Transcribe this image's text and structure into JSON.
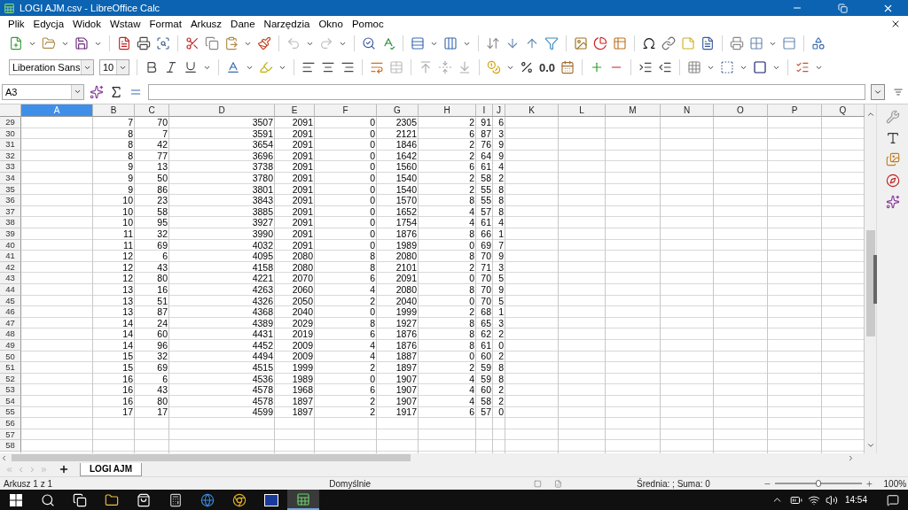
{
  "window": {
    "title": "LOGI AJM.csv - LibreOffice Calc"
  },
  "menu": [
    "Plik",
    "Edycja",
    "Widok",
    "Wstaw",
    "Format",
    "Arkusz",
    "Dane",
    "Narzędzia",
    "Okno",
    "Pomoc"
  ],
  "format_toolbar": {
    "font_name": "Liberation Sans",
    "font_size": "10",
    "decimal_format": "0.0"
  },
  "formula_bar": {
    "name_box": "A3"
  },
  "columns": [
    {
      "label": "A",
      "selected": true
    },
    {
      "label": "B",
      "selected": false
    },
    {
      "label": "C",
      "selected": false
    },
    {
      "label": "D",
      "selected": false
    },
    {
      "label": "E",
      "selected": false
    },
    {
      "label": "F",
      "selected": false
    },
    {
      "label": "G",
      "selected": false
    },
    {
      "label": "H",
      "selected": false
    },
    {
      "label": "I",
      "selected": false
    },
    {
      "label": "J",
      "selected": false
    },
    {
      "label": "K",
      "selected": false
    },
    {
      "label": "L",
      "selected": false
    },
    {
      "label": "M",
      "selected": false
    },
    {
      "label": "N",
      "selected": false
    },
    {
      "label": "O",
      "selected": false
    },
    {
      "label": "P",
      "selected": false
    },
    {
      "label": "Q",
      "selected": false
    }
  ],
  "rows": [
    {
      "number": "29",
      "values": [
        "7",
        "70",
        "3507",
        "2091",
        "0",
        "2305",
        "2",
        "91",
        "6"
      ]
    },
    {
      "number": "30",
      "values": [
        "8",
        "7",
        "3591",
        "2091",
        "0",
        "2121",
        "6",
        "87",
        "3"
      ]
    },
    {
      "number": "31",
      "values": [
        "8",
        "42",
        "3654",
        "2091",
        "0",
        "1846",
        "2",
        "76",
        "9"
      ]
    },
    {
      "number": "32",
      "values": [
        "8",
        "77",
        "3696",
        "2091",
        "0",
        "1642",
        "2",
        "64",
        "9"
      ]
    },
    {
      "number": "33",
      "values": [
        "9",
        "13",
        "3738",
        "2091",
        "0",
        "1560",
        "6",
        "61",
        "4"
      ]
    },
    {
      "number": "34",
      "values": [
        "9",
        "50",
        "3780",
        "2091",
        "0",
        "1540",
        "2",
        "58",
        "2"
      ]
    },
    {
      "number": "35",
      "values": [
        "9",
        "86",
        "3801",
        "2091",
        "0",
        "1540",
        "2",
        "55",
        "8"
      ]
    },
    {
      "number": "36",
      "values": [
        "10",
        "23",
        "3843",
        "2091",
        "0",
        "1570",
        "8",
        "55",
        "8"
      ]
    },
    {
      "number": "37",
      "values": [
        "10",
        "58",
        "3885",
        "2091",
        "0",
        "1652",
        "4",
        "57",
        "8"
      ]
    },
    {
      "number": "38",
      "values": [
        "10",
        "95",
        "3927",
        "2091",
        "0",
        "1754",
        "4",
        "61",
        "4"
      ]
    },
    {
      "number": "39",
      "values": [
        "11",
        "32",
        "3990",
        "2091",
        "0",
        "1876",
        "8",
        "66",
        "1"
      ]
    },
    {
      "number": "40",
      "values": [
        "11",
        "69",
        "4032",
        "2091",
        "0",
        "1989",
        "0",
        "69",
        "7"
      ]
    },
    {
      "number": "41",
      "values": [
        "12",
        "6",
        "4095",
        "2080",
        "8",
        "2080",
        "8",
        "70",
        "9"
      ]
    },
    {
      "number": "42",
      "values": [
        "12",
        "43",
        "4158",
        "2080",
        "8",
        "2101",
        "2",
        "71",
        "3"
      ]
    },
    {
      "number": "43",
      "values": [
        "12",
        "80",
        "4221",
        "2070",
        "6",
        "2091",
        "0",
        "70",
        "5"
      ]
    },
    {
      "number": "44",
      "values": [
        "13",
        "16",
        "4263",
        "2060",
        "4",
        "2080",
        "8",
        "70",
        "9"
      ]
    },
    {
      "number": "45",
      "values": [
        "13",
        "51",
        "4326",
        "2050",
        "2",
        "2040",
        "0",
        "70",
        "5"
      ]
    },
    {
      "number": "46",
      "values": [
        "13",
        "87",
        "4368",
        "2040",
        "0",
        "1999",
        "2",
        "68",
        "1"
      ]
    },
    {
      "number": "47",
      "values": [
        "14",
        "24",
        "4389",
        "2029",
        "8",
        "1927",
        "8",
        "65",
        "3"
      ]
    },
    {
      "number": "48",
      "values": [
        "14",
        "60",
        "4431",
        "2019",
        "6",
        "1876",
        "8",
        "62",
        "2"
      ]
    },
    {
      "number": "49",
      "values": [
        "14",
        "96",
        "4452",
        "2009",
        "4",
        "1876",
        "8",
        "61",
        "0"
      ]
    },
    {
      "number": "50",
      "values": [
        "15",
        "32",
        "4494",
        "2009",
        "4",
        "1887",
        "0",
        "60",
        "2"
      ]
    },
    {
      "number": "51",
      "values": [
        "15",
        "69",
        "4515",
        "1999",
        "2",
        "1897",
        "2",
        "59",
        "8"
      ]
    },
    {
      "number": "52",
      "values": [
        "16",
        "6",
        "4536",
        "1989",
        "0",
        "1907",
        "4",
        "59",
        "8"
      ]
    },
    {
      "number": "53",
      "values": [
        "16",
        "43",
        "4578",
        "1968",
        "6",
        "1907",
        "4",
        "60",
        "2"
      ]
    },
    {
      "number": "54",
      "values": [
        "16",
        "80",
        "4578",
        "1897",
        "2",
        "1907",
        "4",
        "58",
        "2"
      ]
    },
    {
      "number": "55",
      "values": [
        "17",
        "17",
        "4599",
        "1897",
        "2",
        "1917",
        "6",
        "57",
        "0"
      ]
    },
    {
      "number": "56"
    },
    {
      "number": "57"
    },
    {
      "number": "58"
    }
  ],
  "sheet_tabs": [
    {
      "label": "LOGI AJM",
      "selected": true
    }
  ],
  "status_bar": {
    "sheet": "Arkusz 1 z 1",
    "page_style": "Domyślnie",
    "summary": "Średnia: ; Suma: 0",
    "zoom": "100%",
    "zoom_slider": {
      "level": 0.5
    }
  },
  "taskbar": {
    "clock": "14:54"
  }
}
